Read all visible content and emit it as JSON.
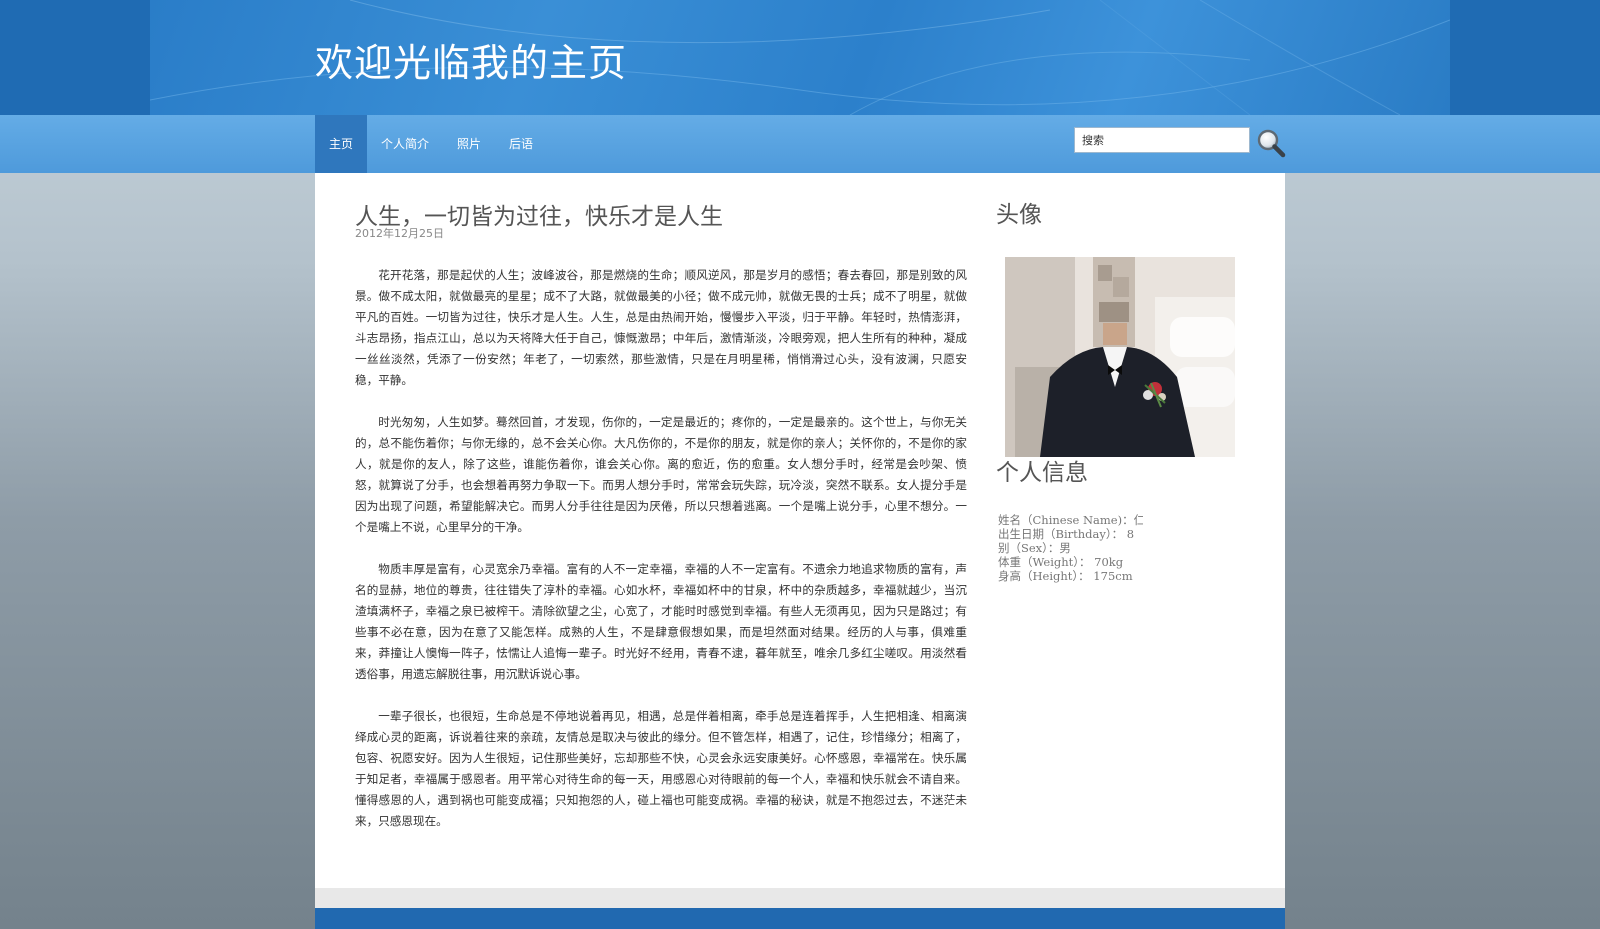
{
  "header": {
    "title": "欢迎光临我的主页"
  },
  "nav": {
    "items": [
      {
        "label": "主页",
        "active": true
      },
      {
        "label": "个人简介",
        "active": false
      },
      {
        "label": "照片",
        "active": false
      },
      {
        "label": "后语",
        "active": false
      }
    ]
  },
  "search": {
    "value": "搜索",
    "icon": "magnifier-icon"
  },
  "post": {
    "title": "人生，一切皆为过往，快乐才是人生",
    "date": "2012年12月25日",
    "paragraphs": [
      "花开花落，那是起伏的人生；波峰波谷，那是燃烧的生命；顺风逆风，那是岁月的感悟；春去春回，那是别致的风景。做不成太阳，就做最亮的星星；成不了大路，就做最美的小径；做不成元帅，就做无畏的士兵；成不了明星，就做平凡的百姓。一切皆为过往，快乐才是人生。人生，总是由热闹开始，慢慢步入平淡，归于平静。年轻时，热情澎湃，斗志昂扬，指点江山，总以为天将降大任于自己，慷慨激昂；中年后，激情渐淡，冷眼旁观，把人生所有的种种，凝成一丝丝淡然，凭添了一份安然；年老了，一切索然，那些激情，只是在月明星稀，悄悄滑过心头，没有波澜，只愿安稳，平静。",
      "时光匆匆，人生如梦。蓦然回首，才发现，伤你的，一定是最近的；疼你的，一定是最亲的。这个世上，与你无关的，总不能伤着你；与你无缘的，总不会关心你。大凡伤你的，不是你的朋友，就是你的亲人；关怀你的，不是你的家人，就是你的友人，除了这些，谁能伤着你，谁会关心你。离的愈近，伤的愈重。女人想分手时，经常是会吵架、愤怒，就算说了分手，也会想着再努力争取一下。而男人想分手时，常常会玩失踪，玩冷淡，突然不联系。女人提分手是因为出现了问题，希望能解决它。而男人分手往往是因为厌倦，所以只想着逃离。一个是嘴上说分手，心里不想分。一个是嘴上不说，心里早分的干净。",
      "物质丰厚是富有，心灵宽余乃幸福。富有的人不一定幸福，幸福的人不一定富有。不遗余力地追求物质的富有，声名的显赫，地位的尊贵，往往错失了淳朴的幸福。心如水杯，幸福如杯中的甘泉，杯中的杂质越多，幸福就越少，当沉渣填满杯子，幸福之泉已被榨干。清除欲望之尘，心宽了，才能时时感觉到幸福。有些人无须再见，因为只是路过；有些事不必在意，因为在意了又能怎样。成熟的人生，不是肆意假想如果，而是坦然面对结果。经历的人与事，俱难重来，莽撞让人懊悔一阵子，怯懦让人追悔一辈子。时光好不经用，青春不逮，暮年就至，唯余几多红尘嗟叹。用淡然看透俗事，用遗忘解脱往事，用沉默诉说心事。",
      "一辈子很长，也很短，生命总是不停地说着再见，相遇，总是伴着相离，牵手总是连着挥手，人生把相逢、相离演绎成心灵的距离，诉说着往来的亲疏，友情总是取决与彼此的缘分。但不管怎样，相遇了，记住，珍惜缘分；相离了，包容、祝愿安好。因为人生很短，记住那些美好，忘却那些不快，心灵会永远安康美好。心怀感恩，幸福常在。快乐属于知足者，幸福属于感恩者。用平常心对待生命的每一天，用感恩心对待眼前的每一个人，幸福和快乐就会不请自来。懂得感恩的人，遇到祸也可能变成福；只知抱怨的人，碰上福也可能变成祸。幸福的秘诀，就是不抱怨过去，不迷茫未来，只感恩现在。"
    ]
  },
  "sidebar": {
    "avatar_title": "头像",
    "info_title": "个人信息",
    "info": [
      "姓名（Chinese Name)：仁",
      "出生日期（Birthday）：  8",
      "别（Sex）：男",
      "体重（Weight）：  70kg",
      "身高（Height）：  175cm"
    ]
  }
}
